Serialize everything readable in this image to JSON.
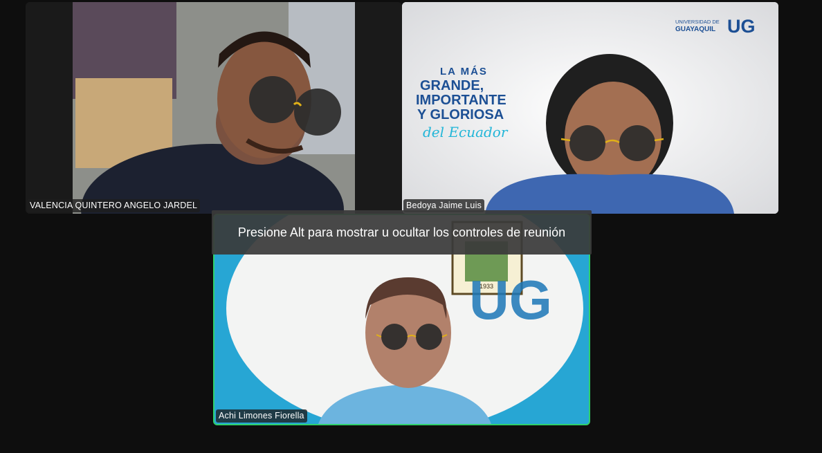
{
  "participants": [
    {
      "name": "VALENCIA QUINTERO ANGELO JARDEL"
    },
    {
      "name": "Bedoya Jaime Luis"
    },
    {
      "name": "Achi Limones Fiorella"
    }
  ],
  "meeting_hint": "Presione Alt para mostrar u ocultar los controles de reunión",
  "background_slogan": {
    "line1": "LA MÁS",
    "line2": "GRANDE,",
    "line3": "IMPORTANTE",
    "line4": "Y GLORIOSA",
    "line5": "del Ecuador"
  },
  "ug_logo": {
    "line1": "UNIVERSIDAD DE",
    "line2": "GUAYAQUIL",
    "monogram": "UG"
  },
  "seal_year": "1933",
  "colors": {
    "active_speaker": "#2fd16a",
    "ug_blue": "#1c4f94"
  }
}
